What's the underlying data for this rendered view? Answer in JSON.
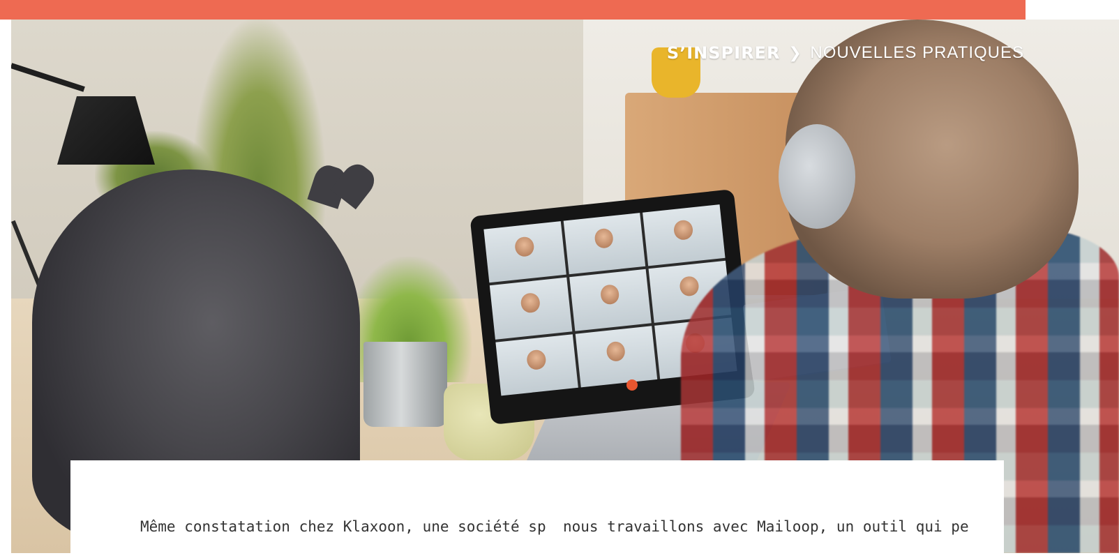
{
  "header": {
    "section": "S’INSPIRER",
    "separator": "❯",
    "subsection": "NOUVELLES PRATIQUES"
  },
  "article": {
    "left_column_line1": "Même constatation chez Klaxoon, une société spé-",
    "right_column_line1": "nous travaillons avec Mailoop, un outil qui permet"
  },
  "colors": {
    "accent_band": "#ee6a52",
    "card_background": "#ffffff",
    "body_text": "#333333"
  }
}
